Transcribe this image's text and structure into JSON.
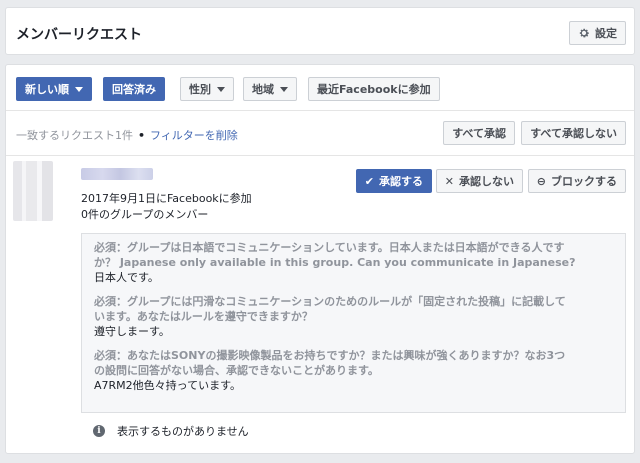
{
  "header": {
    "title": "メンバーリクエスト",
    "settings_label": "設定"
  },
  "filters": {
    "sort_label": "新しい順",
    "answered_label": "回答済み",
    "gender_label": "性別",
    "region_label": "地域",
    "recent_label": "最近Facebookに参加"
  },
  "results": {
    "count_text": "一致するリクエスト1件",
    "remove_filters": "フィルターを削除",
    "approve_all": "すべて承認",
    "decline_all": "すべて承認しない"
  },
  "request": {
    "joined_text": "2017年9月1日にFacebookに参加",
    "groups_text": "0件のグループのメンバー",
    "approve_label": "承認する",
    "decline_label": "承認しない",
    "block_label": "ブロックする",
    "qa": [
      {
        "question_line1": "必須：グループは日本語でコミュニケーションしています。日本人または日本語ができる人です",
        "question_line2": "か？ Japanese only available in this group. Can you communicate in Japanese?",
        "answer": "日本人です。"
      },
      {
        "question_line1": "必須：グループには円滑なコミュニケーションのためのルールが「固定された投稿」に記載して",
        "question_line2": "います。あなたはルールを遵守できますか？",
        "answer": "遵守しまーす。"
      },
      {
        "question_line1": "必須：あなたはSONYの撮影映像製品をお持ちですか？または興味が強くありますか？なお3つ",
        "question_line2": "の設問に回答がない場合、承認できないことがあります。",
        "answer": "A7RM2他色々持っています。"
      }
    ],
    "empty_note": "表示するものがありません"
  },
  "colors": {
    "accent": "#4267b2",
    "background": "#e9ebee"
  }
}
